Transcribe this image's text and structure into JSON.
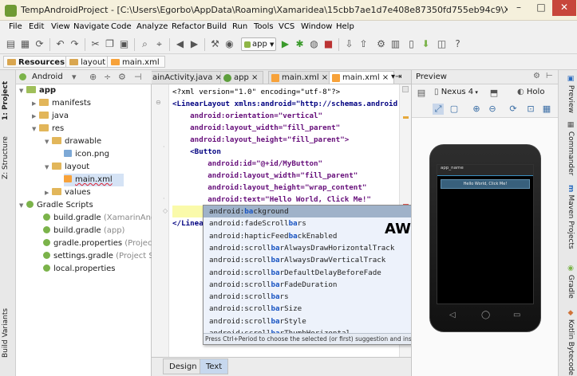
{
  "window": {
    "title": "TempAndroidProject - [C:\\Users\\Egorbo\\AppData\\Roaming\\Xamaridea\\15cbb7ae1d7e408e87350fd755eb94c9\\X..."
  },
  "menu": [
    "File",
    "Edit",
    "View",
    "Navigate",
    "Code",
    "Analyze",
    "Refactor",
    "Build",
    "Run",
    "Tools",
    "VCS",
    "Window",
    "Help"
  ],
  "toolbar": {
    "run_config": "app"
  },
  "breadcrumb": [
    "Resources",
    "layout",
    "main.xml"
  ],
  "left_strip": [
    "1: Project",
    "Z: Structure",
    "Build Variants"
  ],
  "project": {
    "view": "Android",
    "tree": [
      {
        "label": "app",
        "level": 0,
        "icon": "module-icon",
        "bold": true
      },
      {
        "label": "manifests",
        "level": 1,
        "icon": "folder-icon"
      },
      {
        "label": "java",
        "level": 1,
        "icon": "folder-icon"
      },
      {
        "label": "res",
        "level": 1,
        "icon": "folder-icon"
      },
      {
        "label": "drawable",
        "level": 2,
        "icon": "folder-icon"
      },
      {
        "label": "icon.png",
        "level": 3,
        "icon": "image-file-icon"
      },
      {
        "label": "layout",
        "level": 2,
        "icon": "folder-icon"
      },
      {
        "label": "main.xml",
        "level": 3,
        "icon": "xml-file-icon",
        "selected": true
      },
      {
        "label": "values",
        "level": 2,
        "icon": "folder-icon"
      },
      {
        "label": "Gradle Scripts",
        "level": 0,
        "icon": "gradle-icon"
      },
      {
        "label": "build.gradle",
        "suffix": "(XamarinAndro",
        "level": 1,
        "icon": "gradle-icon"
      },
      {
        "label": "build.gradle",
        "suffix": "(app)",
        "level": 1,
        "icon": "gradle-icon"
      },
      {
        "label": "gradle.properties",
        "suffix": "(Project Pr",
        "level": 1,
        "icon": "gradle-icon"
      },
      {
        "label": "settings.gradle",
        "suffix": "(Project Sett",
        "level": 1,
        "icon": "gradle-icon"
      },
      {
        "label": "local.properties",
        "level": 1,
        "icon": "gradle-icon"
      }
    ]
  },
  "editor": {
    "tabs": [
      {
        "label": "ainActivity.java",
        "active": false
      },
      {
        "label": "app",
        "active": false
      },
      {
        "label": "main.xml",
        "active": false
      },
      {
        "label": "main.xml",
        "active": true
      }
    ],
    "code": [
      "<?xml version=\"1.0\" encoding=\"utf-8\"?>",
      "<LinearLayout xmlns:android=\"http://schemas.android",
      "    android:orientation=\"vertical\"",
      "    android:layout_width=\"fill_parent\"",
      "    android:layout_height=\"fill_parent\">",
      "    <Button",
      "        android:id=\"@+id/MyButton\"",
      "        android:layout_width=\"fill_parent\"",
      "        android:layout_height=\"wrap_content\"",
      "        android:text=\"Hello World, Click Me!\"",
      "        ba/>",
      "</Linea"
    ],
    "design_tabs": [
      "Design",
      "Text"
    ],
    "active_design_tab": "Text"
  },
  "autocomplete": {
    "query": "ba",
    "suggestions": [
      "android:background",
      "android:fadeScrollbars",
      "android:hapticFeedbackEnabled",
      "android:scrollbarAlwaysDrawHorizontalTrack",
      "android:scrollbarAlwaysDrawVerticalTrack",
      "android:scrollbarDefaultDelayBeforeFade",
      "android:scrollbarFadeDuration",
      "android:scrollbars",
      "android:scrollbarSize",
      "android:scrollbarStyle",
      "android:scrollbarThumbHorizontal"
    ],
    "hint": "Press Ctrl+Period to choose the selected (or first) suggestion and insert a dot afterwards",
    "hint_link": ">>",
    "hint_pi": "π",
    "overlay_text": "AWESOME!"
  },
  "preview": {
    "title": "Preview",
    "device": "Nexus 4",
    "theme": "Holo",
    "app_name": "app_name",
    "button_text": "Hello World, Click Me!"
  },
  "right_strip": [
    "Preview",
    "Commander",
    "Maven Projects",
    "Gradle",
    "Kotlin Bytecode"
  ],
  "colors": {
    "accent": "#3b8fbf",
    "title_bar": "#f5f0dc",
    "selection": "#d5e3f5",
    "autocomplete_bg": "#edf2fb",
    "autocomplete_selected": "#9fb2c9"
  }
}
